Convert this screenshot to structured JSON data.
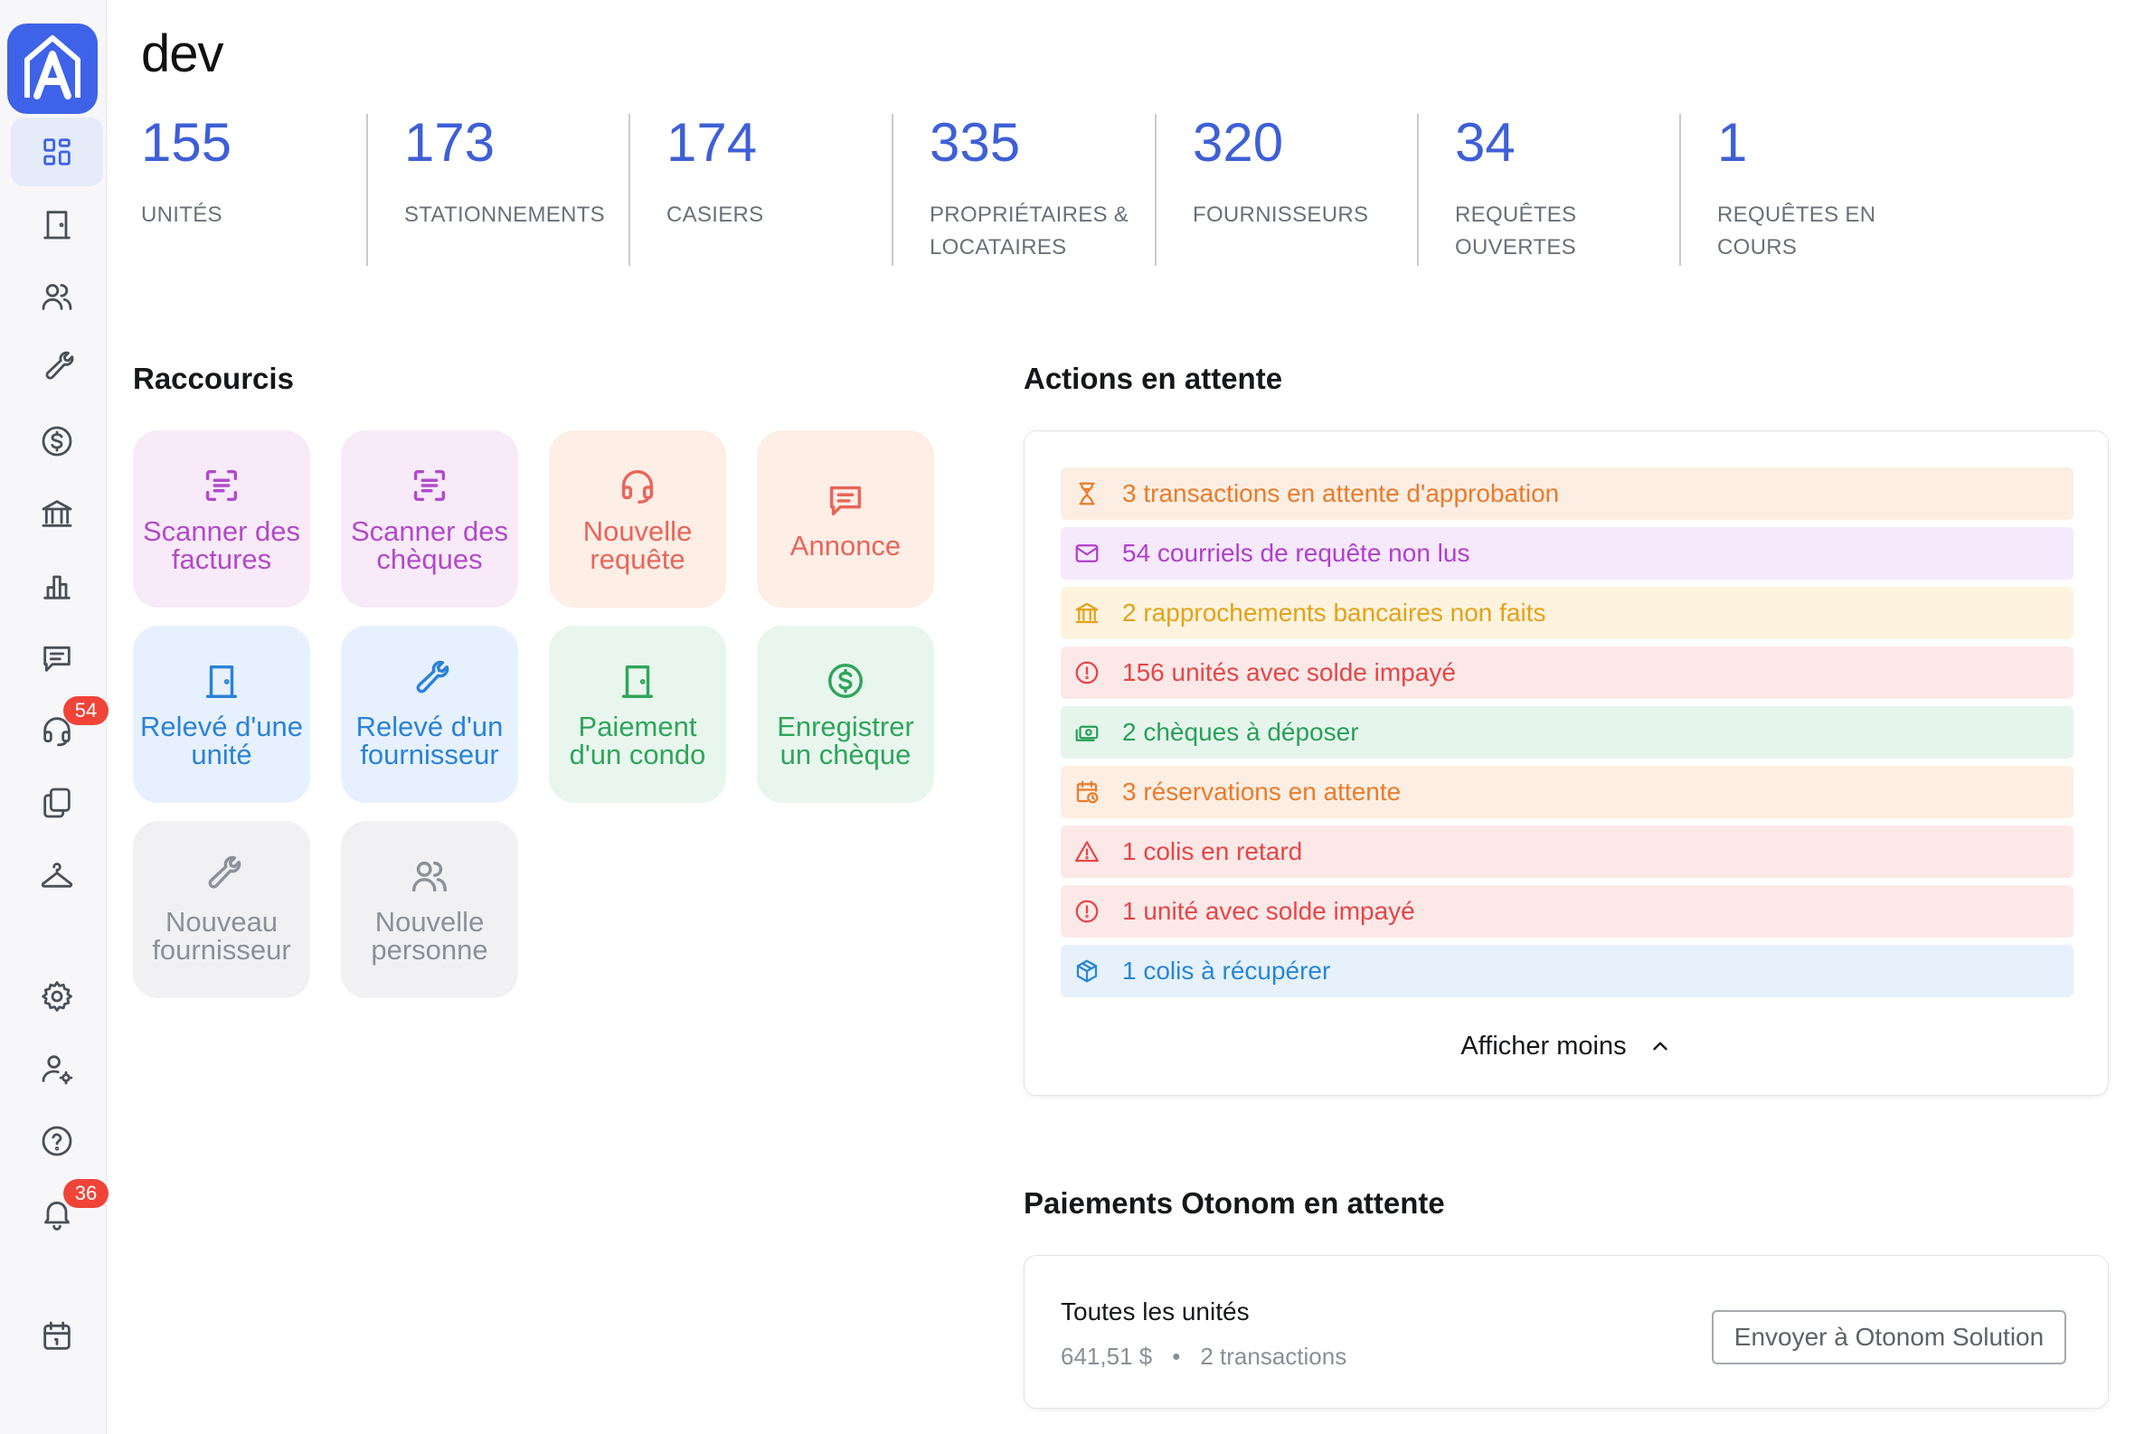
{
  "sidebar": {
    "nav": [
      {
        "key": "dashboard",
        "icon": "dashboard-grid-icon",
        "active": true
      },
      {
        "key": "units",
        "icon": "door-icon"
      },
      {
        "key": "people",
        "icon": "users-icon"
      },
      {
        "key": "suppliers",
        "icon": "wrench-icon"
      },
      {
        "key": "finances",
        "icon": "dollar-circle-icon"
      },
      {
        "key": "bank",
        "icon": "bank-icon"
      },
      {
        "key": "reports",
        "icon": "bar-chart-icon"
      },
      {
        "key": "messages",
        "icon": "message-icon"
      },
      {
        "key": "requests",
        "icon": "headset-icon",
        "badge": "54"
      },
      {
        "key": "documents",
        "icon": "documents-icon"
      },
      {
        "key": "amenities",
        "icon": "hanger-icon"
      },
      {
        "key": "settings",
        "icon": "gear-icon"
      },
      {
        "key": "account",
        "icon": "user-settings-icon"
      },
      {
        "key": "help",
        "icon": "help-icon"
      },
      {
        "key": "notifications",
        "icon": "bell-icon",
        "badge": "36"
      },
      {
        "key": "calendar",
        "icon": "calendar-icon"
      }
    ]
  },
  "header": {
    "title": "dev"
  },
  "stats": [
    {
      "value": "155",
      "label": "Unités"
    },
    {
      "value": "173",
      "label": "Stationnements"
    },
    {
      "value": "174",
      "label": "Casiers"
    },
    {
      "value": "335",
      "label": "Propriétaires & locataires"
    },
    {
      "value": "320",
      "label": "Fournisseurs"
    },
    {
      "value": "34",
      "label": "Requêtes ouvertes"
    },
    {
      "value": "1",
      "label": "Requêtes en cours"
    }
  ],
  "shortcuts": {
    "title": "Raccourcis",
    "tiles": [
      {
        "label": "Scanner des factures",
        "icon": "scan-document-icon",
        "color": "purple"
      },
      {
        "label": "Scanner des chèques",
        "icon": "scan-document-icon",
        "color": "purple"
      },
      {
        "label": "Nouvelle requête",
        "icon": "headset-icon",
        "color": "orange"
      },
      {
        "label": "Annonce",
        "icon": "message-icon",
        "color": "orange"
      },
      {
        "label": "Relevé d'une unité",
        "icon": "door-icon",
        "color": "blue"
      },
      {
        "label": "Relevé d'un fournisseur",
        "icon": "wrench-icon",
        "color": "blue"
      },
      {
        "label": "Paiement d'un condo",
        "icon": "door-icon",
        "color": "green"
      },
      {
        "label": "Enregistrer un chèque",
        "icon": "dollar-circle-icon",
        "color": "green"
      },
      {
        "label": "Nouveau fournisseur",
        "icon": "wrench-icon",
        "color": "gray"
      },
      {
        "label": "Nouvelle personne",
        "icon": "users-icon",
        "color": "gray"
      }
    ]
  },
  "pending_actions": {
    "title": "Actions en attente",
    "items": [
      {
        "text": "3 transactions en attente d'approbation",
        "icon": "hourglass-icon",
        "color": "orange"
      },
      {
        "text": "54 courriels de requête non lus",
        "icon": "mail-icon",
        "color": "purple"
      },
      {
        "text": "2 rapprochements bancaires non faits",
        "icon": "bank-icon",
        "color": "yellow"
      },
      {
        "text": "156 unités avec solde impayé",
        "icon": "alert-circle-icon",
        "color": "red"
      },
      {
        "text": "2 chèques à déposer",
        "icon": "cash-icon",
        "color": "green"
      },
      {
        "text": "3 réservations en attente",
        "icon": "calendar-clock-icon",
        "color": "orange"
      },
      {
        "text": "1 colis en retard",
        "icon": "warning-triangle-icon",
        "color": "red"
      },
      {
        "text": "1 unité avec solde impayé",
        "icon": "alert-circle-icon",
        "color": "red"
      },
      {
        "text": "1 colis à récupérer",
        "icon": "package-icon",
        "color": "blue"
      }
    ],
    "toggle_label": "Afficher moins"
  },
  "payments": {
    "title": "Paiements Otonom en attente",
    "row": {
      "title": "Toutes les unités",
      "amount": "641,51 $",
      "separator": "•",
      "count": "2 transactions",
      "button": "Envoyer à Otonom Solution"
    }
  }
}
